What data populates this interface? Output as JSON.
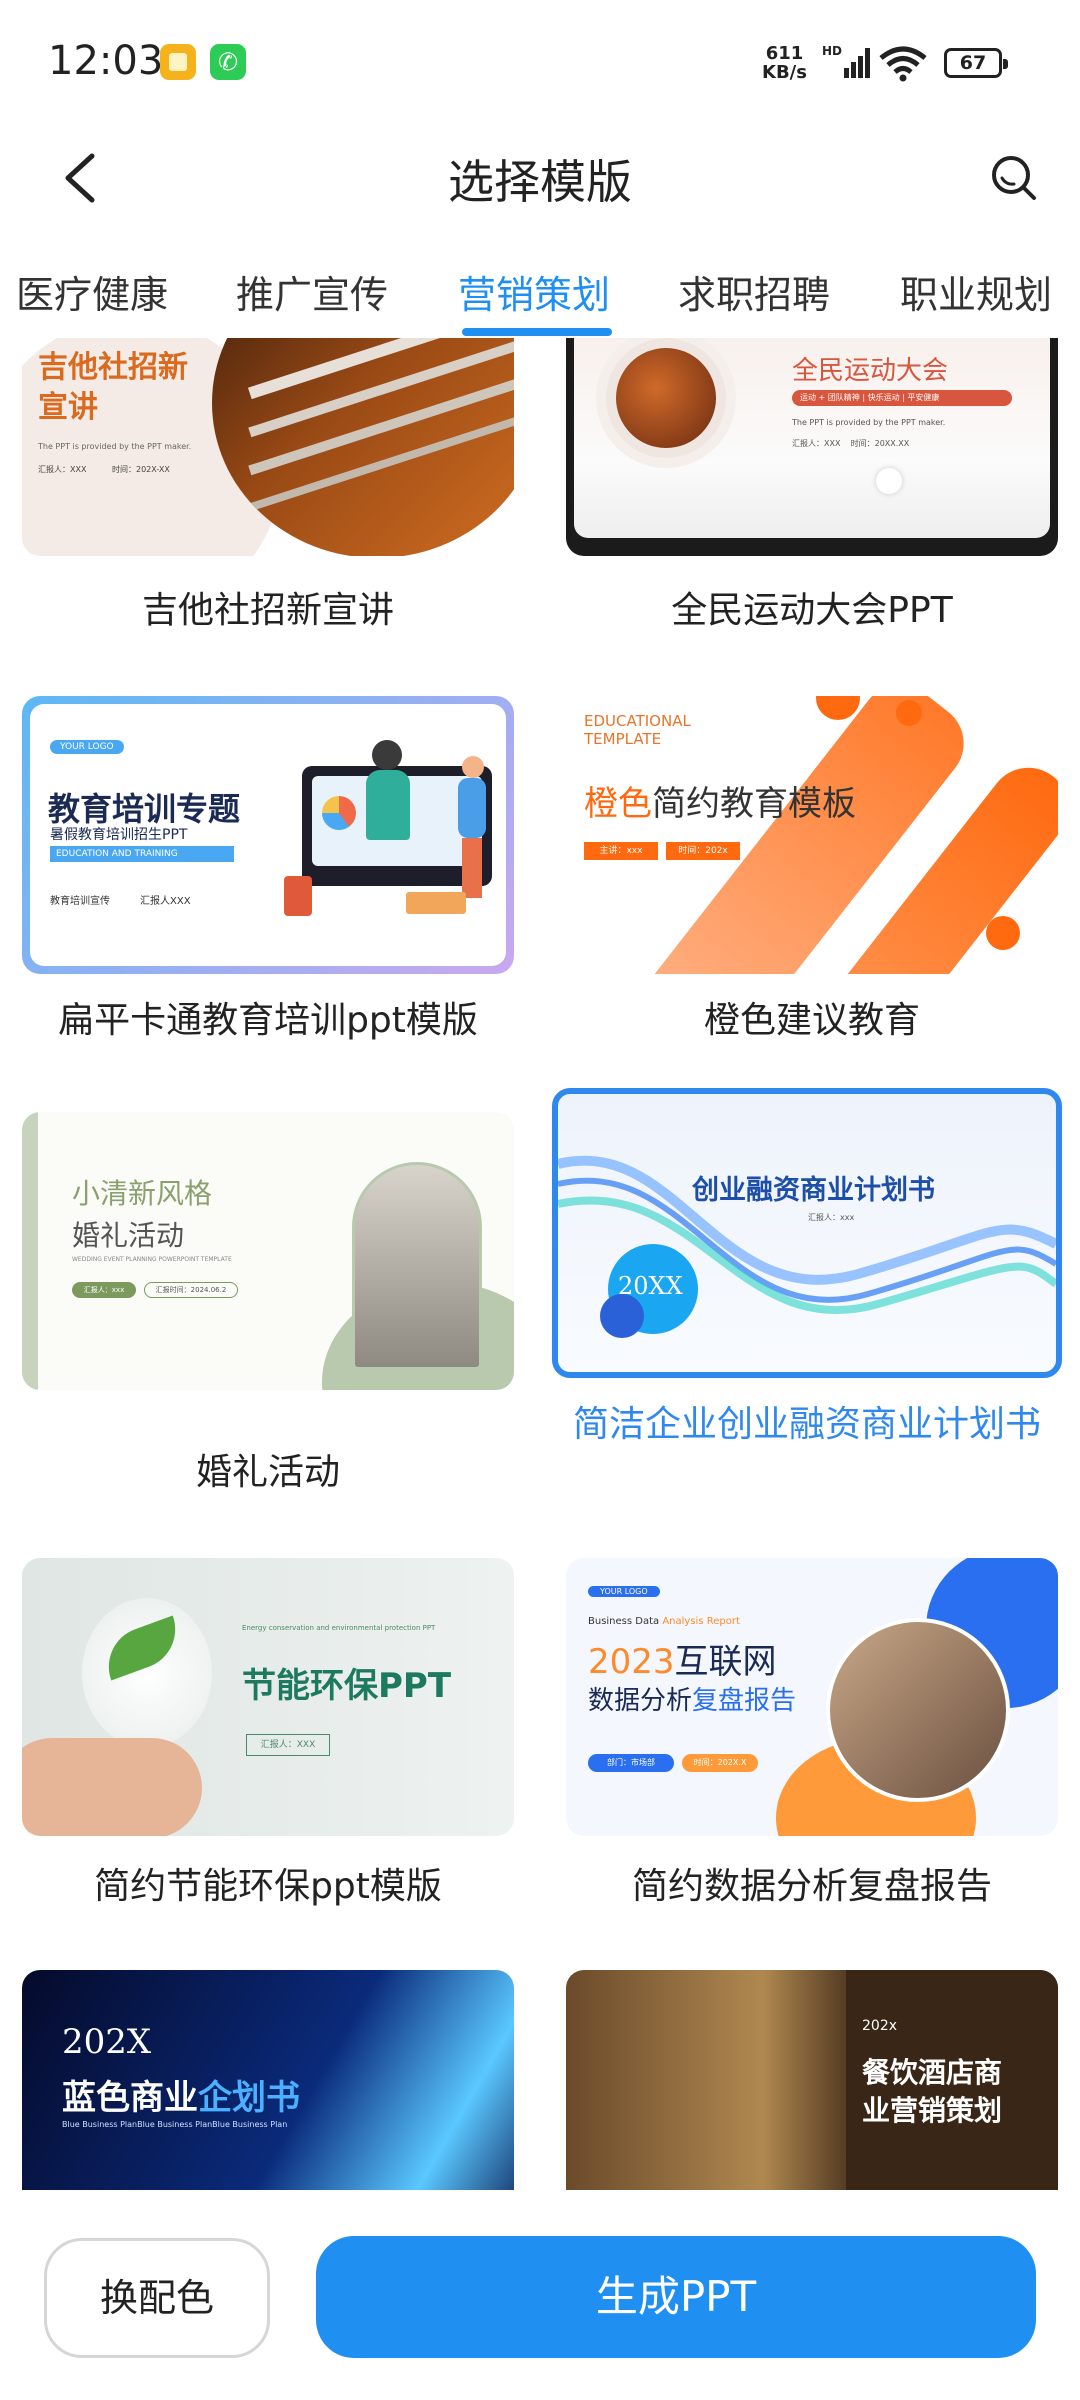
{
  "status": {
    "time": "12:03",
    "net_speed": "611",
    "net_unit": "KB/s",
    "hd": "HD",
    "battery": "67"
  },
  "header": {
    "title": "选择模版"
  },
  "tabs": [
    "医疗健康",
    "推广宣传",
    "营销策划",
    "求职招聘",
    "职业规划"
  ],
  "active_tab": "营销策划",
  "templates": [
    {
      "caption": "吉他社招新宣讲",
      "thumb_title": "吉他社招新\n宣讲",
      "thumb_sub": "The PPT is provided by the PPT maker.",
      "thumb_meta1": "汇报人：XXX",
      "thumb_meta2": "时间：202X-XX"
    },
    {
      "caption": "全民运动大会PPT",
      "thumb_title": "全民运动大会",
      "thumb_tag": "运动 + 团队精神 | 快乐运动 | 平安健康",
      "thumb_sub": "The PPT is provided by the PPT maker.",
      "thumb_meta": "汇报人：XXX    时间：20XX.XX"
    },
    {
      "caption": "扁平卡通教育培训ppt模版",
      "thumb_logo": "YOUR LOGO",
      "thumb_title": "教育培训专题",
      "thumb_sub": "暑假教育培训招生PPT",
      "thumb_en": "EDUCATION AND TRAINING",
      "thumb_meta1": "教育培训宣传",
      "thumb_meta2": "汇报人XXX"
    },
    {
      "caption": "橙色建议教育",
      "thumb_en": "EDUCATIONAL\nTEMPLATE",
      "thumb_title_a": "橙色",
      "thumb_title_b": "简约教育模板",
      "thumb_meta1": "主讲：xxx",
      "thumb_meta2": "时间：202x"
    },
    {
      "caption": "婚礼活动",
      "thumb_title1": "小清新风格",
      "thumb_title2": "婚礼活动",
      "thumb_en": "WEDDING EVENT PLANNING POWERPOINT TEMPLATE",
      "thumb_meta1": "汇报人：xxx",
      "thumb_meta2": "汇报时间：2024.06.2"
    },
    {
      "caption": "简洁企业创业融资商业计划书",
      "thumb_title": "创业融资商业计划书",
      "thumb_sub": "汇报人：xxx",
      "thumb_year": "20XX"
    },
    {
      "caption": "简约节能环保ppt模版",
      "thumb_en": "Energy conservation and environmental protection PPT",
      "thumb_title": "节能环保PPT",
      "thumb_meta": "汇报人：XXX"
    },
    {
      "caption": "简约数据分析复盘报告",
      "thumb_logo": "YOUR LOGO",
      "thumb_en_a": "Business Data ",
      "thumb_en_b": "Analysis Report",
      "thumb_year": "2023",
      "thumb_title": "互联网",
      "thumb_title2_a": "数据分析",
      "thumb_title2_b": "复盘报告",
      "thumb_meta1": "部门：市场部",
      "thumb_meta2": "时间：202X.X"
    },
    {
      "caption": "",
      "thumb_year": "202X",
      "thumb_title_a": "蓝色商业",
      "thumb_title_b": "企划书",
      "thumb_en": "Blue Business PlanBlue Business PlanBlue Business Plan"
    },
    {
      "caption": "",
      "thumb_year": "202x",
      "thumb_title": "餐饮酒店商\n业营销策划"
    }
  ],
  "bottom": {
    "change_color": "换配色",
    "generate": "生成PPT"
  },
  "colors": {
    "accent": "#1f8ff2",
    "selected_border": "#2f88ee"
  }
}
